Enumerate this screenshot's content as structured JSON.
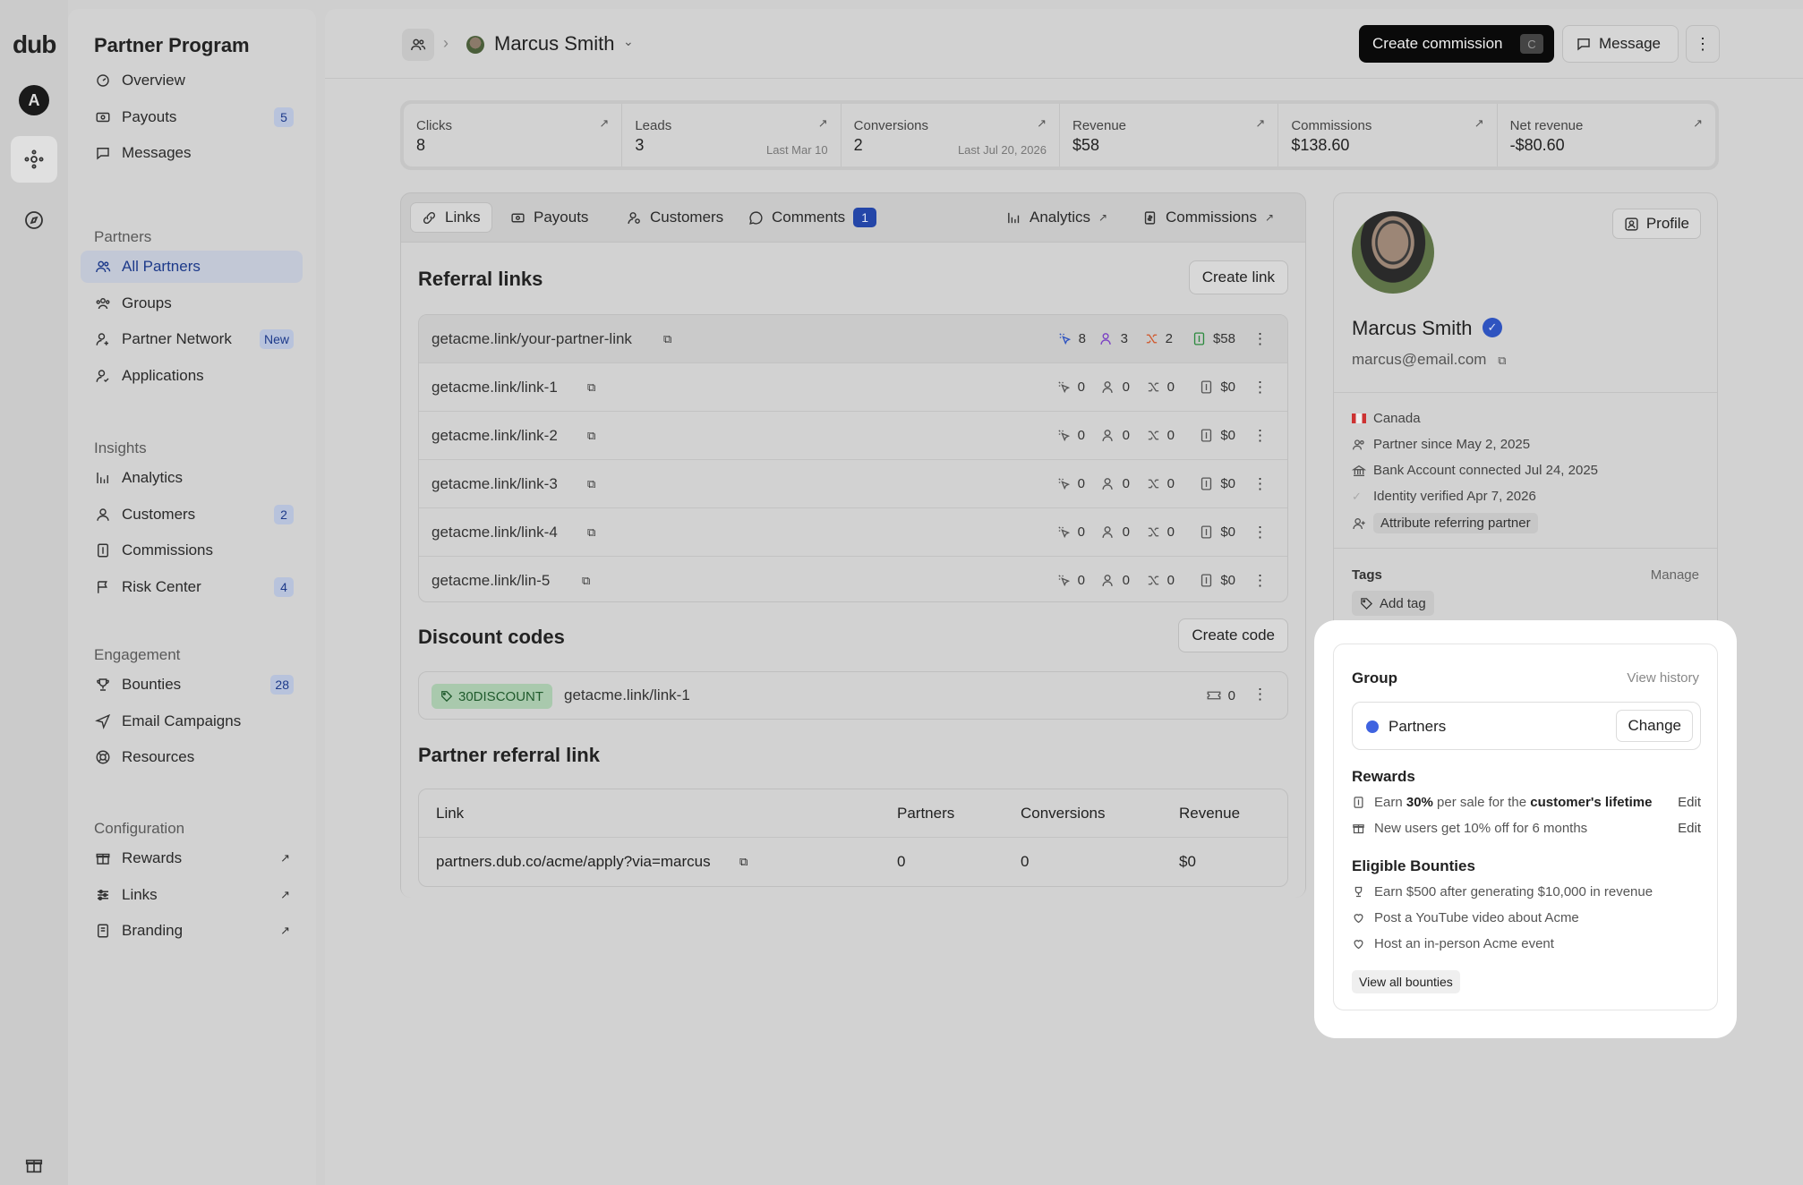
{
  "brand": {
    "logo": "dub",
    "workspace_initial": "A"
  },
  "sidebar": {
    "title": "Partner Program",
    "top_items": [
      {
        "label": "Overview",
        "icon": "overview-icon"
      },
      {
        "label": "Payouts",
        "icon": "payouts-icon",
        "badge": "5"
      },
      {
        "label": "Messages",
        "icon": "messages-icon"
      }
    ],
    "sections": [
      {
        "label": "Partners",
        "items": [
          {
            "label": "All Partners",
            "icon": "users-icon",
            "active": true
          },
          {
            "label": "Groups",
            "icon": "groups-icon"
          },
          {
            "label": "Partner Network",
            "icon": "network-icon",
            "badge": "New"
          },
          {
            "label": "Applications",
            "icon": "applications-icon"
          }
        ]
      },
      {
        "label": "Insights",
        "items": [
          {
            "label": "Analytics",
            "icon": "analytics-icon"
          },
          {
            "label": "Customers",
            "icon": "customers-icon",
            "badge": "2"
          },
          {
            "label": "Commissions",
            "icon": "commissions-icon"
          },
          {
            "label": "Risk Center",
            "icon": "flag-icon",
            "badge": "4"
          }
        ]
      },
      {
        "label": "Engagement",
        "items": [
          {
            "label": "Bounties",
            "icon": "trophy-icon",
            "badge": "28"
          },
          {
            "label": "Email Campaigns",
            "icon": "send-icon"
          },
          {
            "label": "Resources",
            "icon": "lifebuoy-icon"
          }
        ]
      },
      {
        "label": "Configuration",
        "items": [
          {
            "label": "Rewards",
            "icon": "gift-icon",
            "external": "↗"
          },
          {
            "label": "Links",
            "icon": "sliders-icon",
            "external": "↗"
          },
          {
            "label": "Branding",
            "icon": "paint-icon",
            "external": "↗"
          }
        ]
      }
    ]
  },
  "header": {
    "partner_name": "Marcus Smith",
    "create_commission": "Create commission",
    "create_commission_kbd": "C",
    "message": "Message"
  },
  "stats": [
    {
      "label": "Clicks",
      "value": "8",
      "sub": ""
    },
    {
      "label": "Leads",
      "value": "3",
      "sub": "Last Mar 10"
    },
    {
      "label": "Conversions",
      "value": "2",
      "sub": "Last Jul 20, 2026"
    },
    {
      "label": "Revenue",
      "value": "$58",
      "sub": ""
    },
    {
      "label": "Commissions",
      "value": "$138.60",
      "sub": ""
    },
    {
      "label": "Net revenue",
      "value": "-$80.60",
      "sub": ""
    }
  ],
  "tabs": {
    "links": "Links",
    "payouts": "Payouts",
    "customers": "Customers",
    "comments": "Comments",
    "comments_badge": "1",
    "analytics": "Analytics",
    "commissions": "Commissions"
  },
  "referral_links": {
    "title": "Referral links",
    "create_label": "Create link",
    "rows": [
      {
        "url": "getacme.link/your-partner-link",
        "clicks": "8",
        "leads": "3",
        "conversions": "2",
        "revenue": "$58",
        "colored": true
      },
      {
        "url": "getacme.link/link-1",
        "clicks": "0",
        "leads": "0",
        "conversions": "0",
        "revenue": "$0"
      },
      {
        "url": "getacme.link/link-2",
        "clicks": "0",
        "leads": "0",
        "conversions": "0",
        "revenue": "$0"
      },
      {
        "url": "getacme.link/link-3",
        "clicks": "0",
        "leads": "0",
        "conversions": "0",
        "revenue": "$0"
      },
      {
        "url": "getacme.link/link-4",
        "clicks": "0",
        "leads": "0",
        "conversions": "0",
        "revenue": "$0"
      },
      {
        "url": "getacme.link/lin-5",
        "clicks": "0",
        "leads": "0",
        "conversions": "0",
        "revenue": "$0"
      }
    ]
  },
  "discount_codes": {
    "title": "Discount codes",
    "create_label": "Create code",
    "code": "30DISCOUNT",
    "link": "getacme.link/link-1",
    "uses": "0"
  },
  "partner_referral": {
    "title": "Partner referral link",
    "columns": [
      "Link",
      "Partners",
      "Conversions",
      "Revenue"
    ],
    "row": [
      "partners.dub.co/acme/apply?via=marcus",
      "0",
      "0",
      "$0"
    ]
  },
  "profile": {
    "button": "Profile",
    "name": "Marcus Smith",
    "email": "marcus@email.com",
    "country": "Canada",
    "partner_since": "Partner since May 2, 2025",
    "bank": "Bank Account connected Jul 24, 2025",
    "identity": "Identity verified Apr 7, 2026",
    "attribute": "Attribute referring partner",
    "tags_label": "Tags",
    "manage": "Manage",
    "add_tag": "Add tag"
  },
  "group": {
    "title": "Group",
    "view_history": "View history",
    "name": "Partners",
    "change": "Change",
    "dot_color": "#3f63e0",
    "rewards_title": "Rewards",
    "reward1_a": "Earn ",
    "reward1_b": "30%",
    "reward1_c": " per sale for the ",
    "reward1_d": "customer's lifetime",
    "reward2": "New users get 10% off for 6 months",
    "edit": "Edit",
    "bounties_title": "Eligible Bounties",
    "bounties": [
      "Earn $500 after generating $10,000 in revenue",
      "Post a YouTube video about Acme",
      "Host an in-person Acme event"
    ],
    "view_all": "View all bounties"
  },
  "colors": {
    "accent": "#2446a8",
    "discount_bg": "#a9c9ad",
    "highlight": "#ffffff"
  }
}
